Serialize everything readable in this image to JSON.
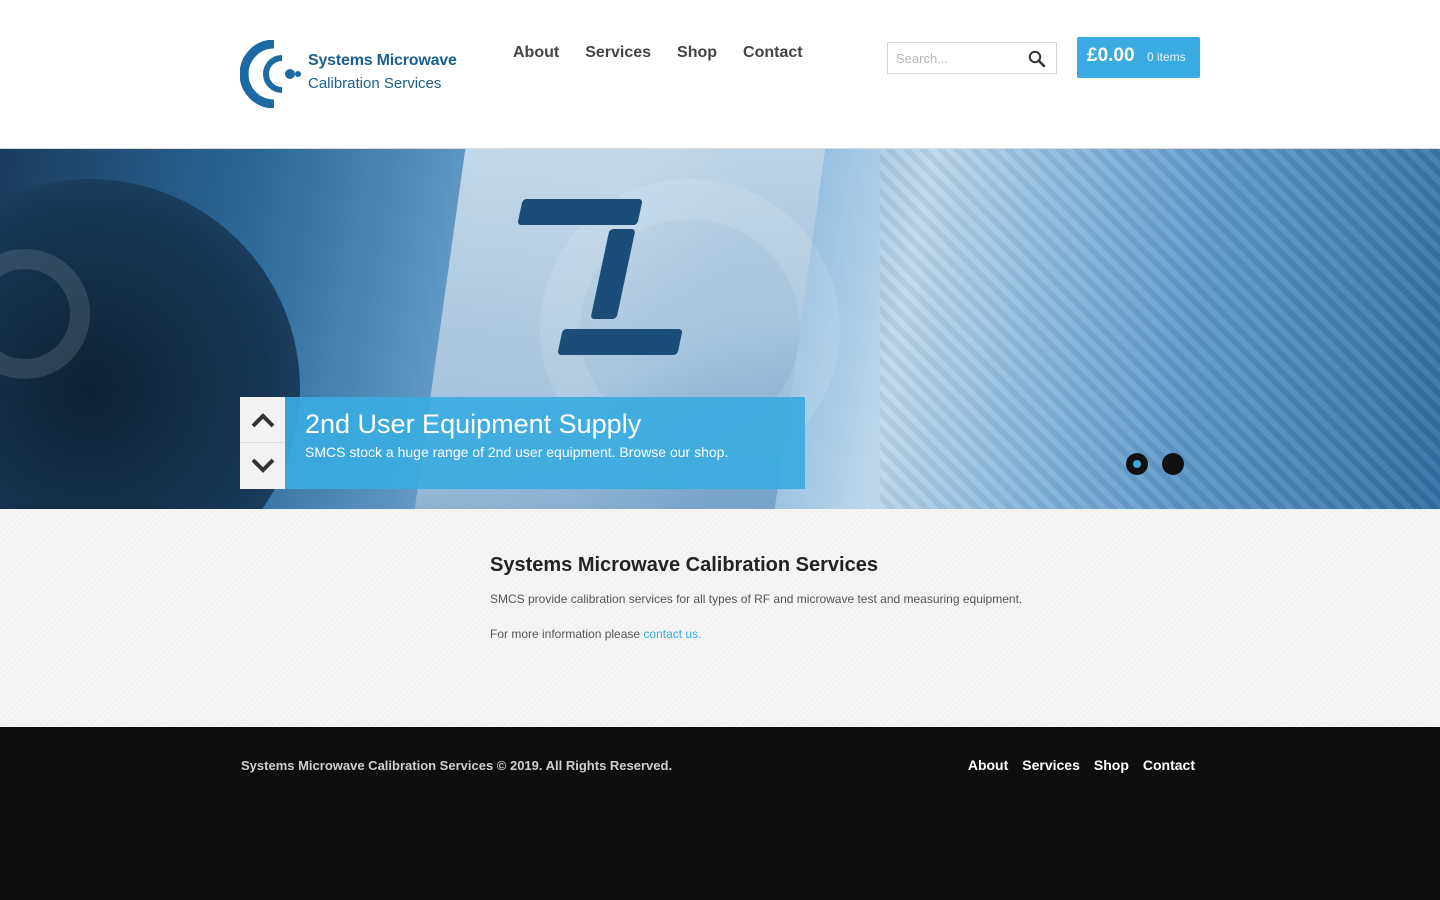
{
  "brand": {
    "name_line1": "Systems Microwave",
    "name_line2": "Calibration Services",
    "color": "#1b5f8f"
  },
  "nav": [
    "About",
    "Services",
    "Shop",
    "Contact"
  ],
  "search": {
    "placeholder": "Search...",
    "icon": "search-icon"
  },
  "cart": {
    "amount": "£0.00",
    "items": "0 items",
    "color": "#3aabe0"
  },
  "hero": {
    "slide_title": "2nd User Equipment Supply",
    "slide_text": "SMCS stock a huge range of 2nd user equipment. Browse our shop.",
    "up_icon": "chevron-up-icon",
    "down_icon": "chevron-down-icon",
    "active_slide": 1,
    "slide_count": 2
  },
  "main": {
    "heading": "Systems Microwave Calibration Services",
    "para1": "SMCS provide calibration services for all types of RF and microwave test and measuring equipment.",
    "para2_prefix": "For more information please ",
    "para2_link": "contact us."
  },
  "footer": {
    "copyright": "Systems Microwave Calibration Services © 2019. All Rights Reserved.",
    "nav": [
      "About",
      "Services",
      "Shop",
      "Contact"
    ]
  }
}
